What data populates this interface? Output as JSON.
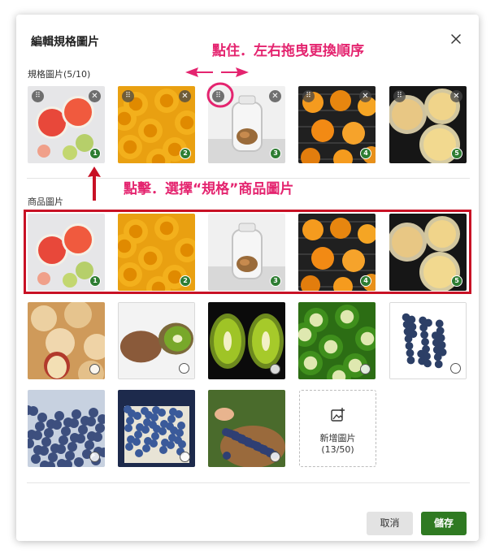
{
  "dialog": {
    "title": "編輯規格圖片",
    "spec_section_label": "規格圖片(5/10)",
    "product_section_label": "商品圖片",
    "spec_images": [
      {
        "name": "grapefruit",
        "order": "1"
      },
      {
        "name": "dried-pineapple",
        "order": "2"
      },
      {
        "name": "glass-jar",
        "order": "3"
      },
      {
        "name": "dried-orange",
        "order": "4"
      },
      {
        "name": "dried-lemon",
        "order": "5"
      }
    ],
    "product_images_selected": [
      {
        "name": "grapefruit",
        "order": "1"
      },
      {
        "name": "dried-pineapple",
        "order": "2"
      },
      {
        "name": "glass-jar",
        "order": "3"
      },
      {
        "name": "dried-orange",
        "order": "4"
      },
      {
        "name": "dried-lemon",
        "order": "5"
      }
    ],
    "product_images_unselected": [
      {
        "name": "dried-apple"
      },
      {
        "name": "kiwi-halves"
      },
      {
        "name": "kiwi-halves-dark"
      },
      {
        "name": "kiwi-slices"
      },
      {
        "name": "blueberries-white"
      },
      {
        "name": "blueberries-pile"
      },
      {
        "name": "blueberries-basket"
      },
      {
        "name": "blueberries-hand"
      }
    ],
    "add_image": {
      "label": "新增圖片",
      "count": "(13/50)"
    },
    "buttons": {
      "cancel": "取消",
      "save": "儲存"
    },
    "accent_color": "#2f7a22",
    "badge_color": "#2e7d32"
  },
  "annotations": {
    "drag_hint": "點住．左右拖曳更換順序",
    "click_hint": "點擊．選擇“規格”商品圖片",
    "color": "#e4246f",
    "box_color": "#c81125"
  }
}
